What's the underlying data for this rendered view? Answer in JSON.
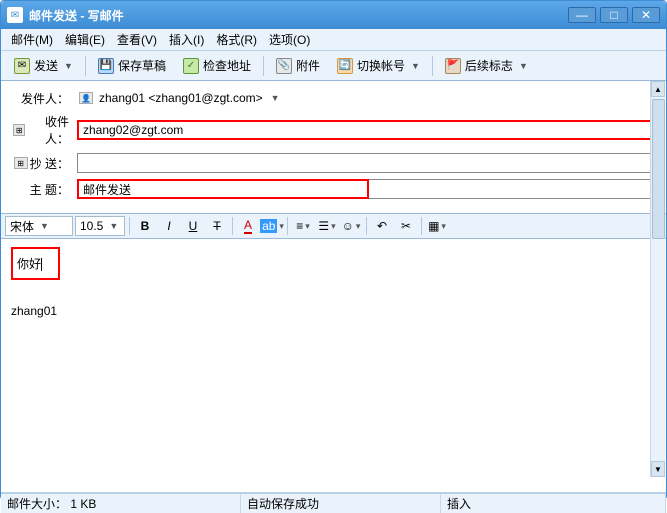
{
  "title": "邮件发送 - 写邮件",
  "menu": [
    "邮件(M)",
    "编辑(E)",
    "查看(V)",
    "插入(I)",
    "格式(R)",
    "选项(O)"
  ],
  "toolbar": {
    "send": "发送",
    "draft": "保存草稿",
    "check": "检查地址",
    "attach": "附件",
    "switch": "切换帐号",
    "flag": "后续标志"
  },
  "hdr": {
    "from_label": "发件人：",
    "from": "zhang01 <zhang01@zgt.com>",
    "to_label": "收件人：",
    "to": "zhang02@zgt.com",
    "cc_label": "抄 送：",
    "cc": "",
    "subj_label": "主 题：",
    "subj": "邮件发送"
  },
  "fmt": {
    "font": "宋体",
    "size": "10.5"
  },
  "body": {
    "l1": "你好",
    "l2": "zhang01"
  },
  "status": {
    "size_label": "邮件大小：",
    "size": "1 KB",
    "autosave": "自动保存成功",
    "insert": "插入"
  }
}
